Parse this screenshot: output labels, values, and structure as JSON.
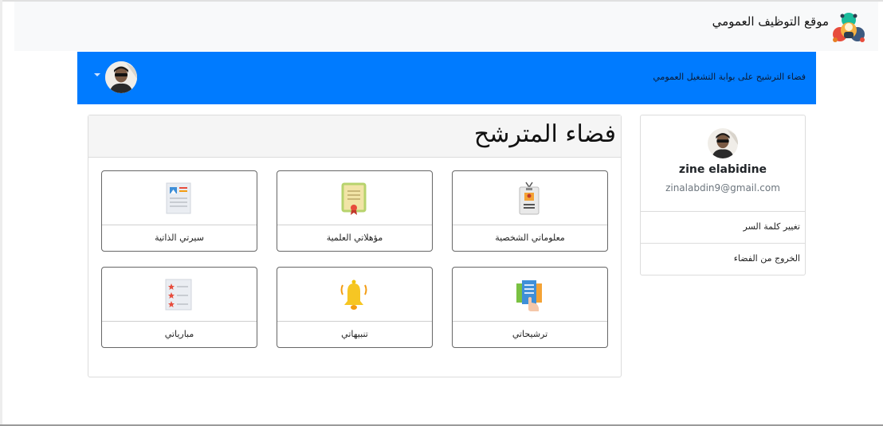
{
  "navbar": {
    "brand_text": "موقع التوظيف العمومي",
    "logo_icon": "recruitment-people-logo"
  },
  "header_bar": {
    "title": "فضاء الترشيح على بوابة التشغيل العمومي",
    "avatar_icon": "user-avatar",
    "dropdown_icon": "caret-down-icon",
    "background": "#007bff"
  },
  "main": {
    "title": "فضاء المترشح",
    "tiles": [
      {
        "label": "معلوماتي الشخصية",
        "icon": "id-badge-icon"
      },
      {
        "label": "مؤهلاتي العلمية",
        "icon": "certificate-icon"
      },
      {
        "label": "سيرتي الذاتية",
        "icon": "resume-icon"
      },
      {
        "label": "ترشيحاتي",
        "icon": "applications-icon"
      },
      {
        "label": "تنبيهاتي",
        "icon": "bell-icon"
      },
      {
        "label": "مبارياتي",
        "icon": "rated-list-icon"
      }
    ]
  },
  "profile": {
    "name": "zine elabidine",
    "email": "zinalabdin9@gmail.com",
    "menu": [
      {
        "label": "تغيير كلمة السر"
      },
      {
        "label": "الخروج من الفضاء"
      }
    ]
  }
}
